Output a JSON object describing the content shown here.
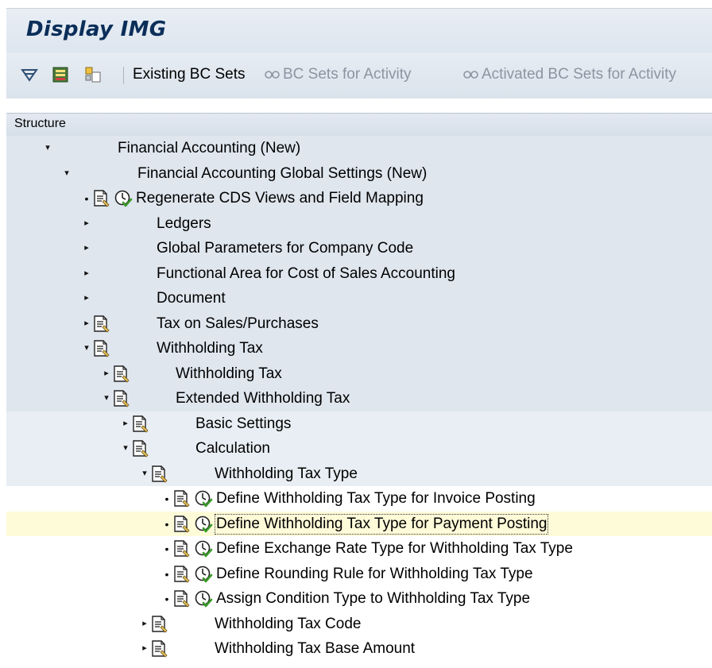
{
  "window": {
    "title": "Display IMG"
  },
  "toolbar": {
    "existing_bc_sets": "Existing BC Sets",
    "bc_sets_for_activity": "BC Sets for Activity",
    "activated_bc_sets": "Activated BC Sets for Activity"
  },
  "structure": {
    "header": "Structure"
  },
  "tree": [
    {
      "label": "Financial Accounting (New)",
      "level": 0,
      "expander": "expanded",
      "doc": false,
      "exec": false
    },
    {
      "label": "Financial Accounting Global Settings (New)",
      "level": 1,
      "expander": "expanded",
      "doc": false,
      "exec": false
    },
    {
      "label": "Regenerate CDS Views and Field Mapping",
      "level": 2,
      "expander": "leaf",
      "doc": true,
      "exec": true
    },
    {
      "label": "Ledgers",
      "level": 2,
      "expander": "collapsed",
      "doc": false,
      "exec": false
    },
    {
      "label": "Global Parameters for Company Code",
      "level": 2,
      "expander": "collapsed",
      "doc": false,
      "exec": false
    },
    {
      "label": "Functional Area for Cost of Sales Accounting",
      "level": 2,
      "expander": "collapsed",
      "doc": false,
      "exec": false
    },
    {
      "label": "Document",
      "level": 2,
      "expander": "collapsed",
      "doc": false,
      "exec": false
    },
    {
      "label": "Tax on Sales/Purchases",
      "level": 2,
      "expander": "collapsed",
      "doc": true,
      "exec": false
    },
    {
      "label": "Withholding Tax",
      "level": 2,
      "expander": "expanded",
      "doc": true,
      "exec": false
    },
    {
      "label": "Withholding Tax",
      "level": 3,
      "expander": "collapsed",
      "doc": true,
      "exec": false
    },
    {
      "label": "Extended Withholding Tax",
      "level": 3,
      "expander": "expanded",
      "doc": true,
      "exec": false
    },
    {
      "label": "Basic Settings",
      "level": 4,
      "expander": "collapsed",
      "doc": true,
      "exec": false
    },
    {
      "label": "Calculation",
      "level": 4,
      "expander": "expanded",
      "doc": true,
      "exec": false
    },
    {
      "label": "Withholding Tax Type",
      "level": 5,
      "expander": "expanded",
      "doc": true,
      "exec": false
    },
    {
      "label": "Define Withholding Tax Type for Invoice Posting",
      "level": 6,
      "expander": "leaf",
      "doc": true,
      "exec": true
    },
    {
      "label": "Define Withholding Tax Type for Payment Posting",
      "level": 6,
      "expander": "leaf",
      "doc": true,
      "exec": true,
      "selected": true
    },
    {
      "label": "Define Exchange Rate Type for Withholding Tax Type",
      "level": 6,
      "expander": "leaf",
      "doc": true,
      "exec": true
    },
    {
      "label": "Define Rounding Rule for Withholding Tax Type",
      "level": 6,
      "expander": "leaf",
      "doc": true,
      "exec": true
    },
    {
      "label": "Assign Condition Type to Withholding Tax Type",
      "level": 6,
      "expander": "leaf",
      "doc": true,
      "exec": true
    },
    {
      "label": "Withholding Tax Code",
      "level": 5,
      "expander": "collapsed",
      "doc": true,
      "exec": false
    },
    {
      "label": "Withholding Tax Base Amount",
      "level": 5,
      "expander": "collapsed",
      "doc": true,
      "exec": false
    }
  ]
}
